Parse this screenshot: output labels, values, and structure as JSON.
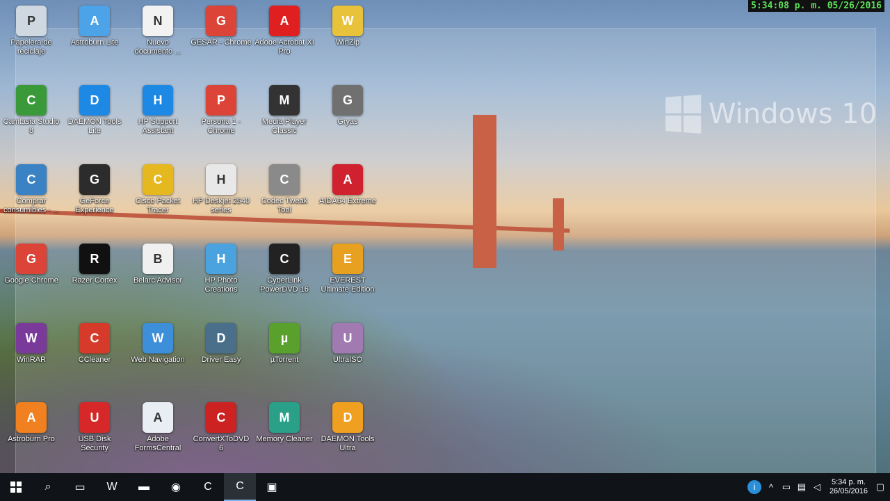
{
  "recorder_timestamp": "5:34:08 p. m. 05/26/2016",
  "watermark": "Windows 10",
  "icons": [
    {
      "label": "Papelera de reciclaje",
      "icon": "recycle-bin-icon",
      "color": "#cfd8e0"
    },
    {
      "label": "Astroburn Lite",
      "icon": "astroburn-lite-icon",
      "color": "#4da3e8"
    },
    {
      "label": "Nuevo documento ...",
      "icon": "text-document-icon",
      "color": "#f2f2f2"
    },
    {
      "label": "GESAR - Chrome",
      "icon": "chrome-icon",
      "color": "#db4437"
    },
    {
      "label": "Adobe Acrobat XI Pro",
      "icon": "acrobat-icon",
      "color": "#e02020"
    },
    {
      "label": "WinZip",
      "icon": "winzip-icon",
      "color": "#e8c23a"
    },
    {
      "label": "Camtasia Studio 8",
      "icon": "camtasia-icon",
      "color": "#3a9a3a"
    },
    {
      "label": "DAEMON Tools Lite",
      "icon": "daemon-tools-icon",
      "color": "#1e88e5"
    },
    {
      "label": "HP Support Assistant",
      "icon": "help-icon",
      "color": "#1e88e5"
    },
    {
      "label": "Persona 1 - Chrome",
      "icon": "chrome-icon",
      "color": "#db4437"
    },
    {
      "label": "Media Player Classic",
      "icon": "media-player-icon",
      "color": "#333333"
    },
    {
      "label": "Gryas",
      "icon": "game-character-icon",
      "color": "#707070"
    },
    {
      "label": "Comprar consumibles - ...",
      "icon": "printer-shop-icon",
      "color": "#3b82c4"
    },
    {
      "label": "GeForce Experience",
      "icon": "nvidia-icon",
      "color": "#2c2c2c"
    },
    {
      "label": "Cisco Packet Tracer",
      "icon": "packet-tracer-icon",
      "color": "#e5b820"
    },
    {
      "label": "HP Deskjet 2540 series",
      "icon": "printer-icon",
      "color": "#e8e8e8"
    },
    {
      "label": "Codec Tweak Tool",
      "icon": "tools-icon",
      "color": "#8a8a8a"
    },
    {
      "label": "AIDA64 Extreme",
      "icon": "aida64-icon",
      "color": "#d0212f"
    },
    {
      "label": "Google Chrome",
      "icon": "chrome-icon",
      "color": "#db4437"
    },
    {
      "label": "Razer Cortex",
      "icon": "razer-icon",
      "color": "#111111"
    },
    {
      "label": "Belarc Advisor",
      "icon": "belarc-icon",
      "color": "#f0f0f0"
    },
    {
      "label": "HP Photo Creations",
      "icon": "photo-icon",
      "color": "#4aa3df"
    },
    {
      "label": "CyberLink PowerDVD 16",
      "icon": "powerdvd-icon",
      "color": "#222222"
    },
    {
      "label": "EVEREST Ultimate Edition",
      "icon": "everest-icon",
      "color": "#e8a020"
    },
    {
      "label": "WinRAR",
      "icon": "winrar-icon",
      "color": "#7a3a9a"
    },
    {
      "label": "CCleaner",
      "icon": "ccleaner-icon",
      "color": "#d63a2a"
    },
    {
      "label": "Web Navigation",
      "icon": "globe-icon",
      "color": "#3c8fd8"
    },
    {
      "label": "Driver Easy",
      "icon": "driver-easy-icon",
      "color": "#4a6f8a"
    },
    {
      "label": "µTorrent",
      "icon": "utorrent-icon",
      "color": "#5aa02c"
    },
    {
      "label": "UltraISO",
      "icon": "disc-icon",
      "color": "#a07ab0"
    },
    {
      "label": "Astroburn Pro",
      "icon": "astroburn-pro-icon",
      "color": "#f08020"
    },
    {
      "label": "USB Disk Security",
      "icon": "shield-icon",
      "color": "#d62828"
    },
    {
      "label": "Adobe FormsCentral",
      "icon": "forms-icon",
      "color": "#e8eef4"
    },
    {
      "label": "ConvertXToDVD 6",
      "icon": "convertx-icon",
      "color": "#cc2222"
    },
    {
      "label": "Memory Cleaner",
      "icon": "memory-cleaner-icon",
      "color": "#2aa088"
    },
    {
      "label": "DAEMON Tools Ultra",
      "icon": "daemon-ultra-icon",
      "color": "#f0a020"
    }
  ],
  "taskbar": {
    "apps": [
      {
        "icon": "search-icon",
        "glyph": "⌕"
      },
      {
        "icon": "task-view-icon",
        "glyph": "▭"
      },
      {
        "icon": "word-icon",
        "glyph": "W"
      },
      {
        "icon": "file-explorer-icon",
        "glyph": "▬"
      },
      {
        "icon": "chrome-icon",
        "glyph": "◉"
      },
      {
        "icon": "camtasia-icon",
        "glyph": "C"
      },
      {
        "icon": "camtasia-recorder-icon",
        "glyph": "C"
      },
      {
        "icon": "remote-desktop-icon",
        "glyph": "▣"
      }
    ],
    "time": "5:34 p. m.",
    "date": "26/05/2016"
  }
}
